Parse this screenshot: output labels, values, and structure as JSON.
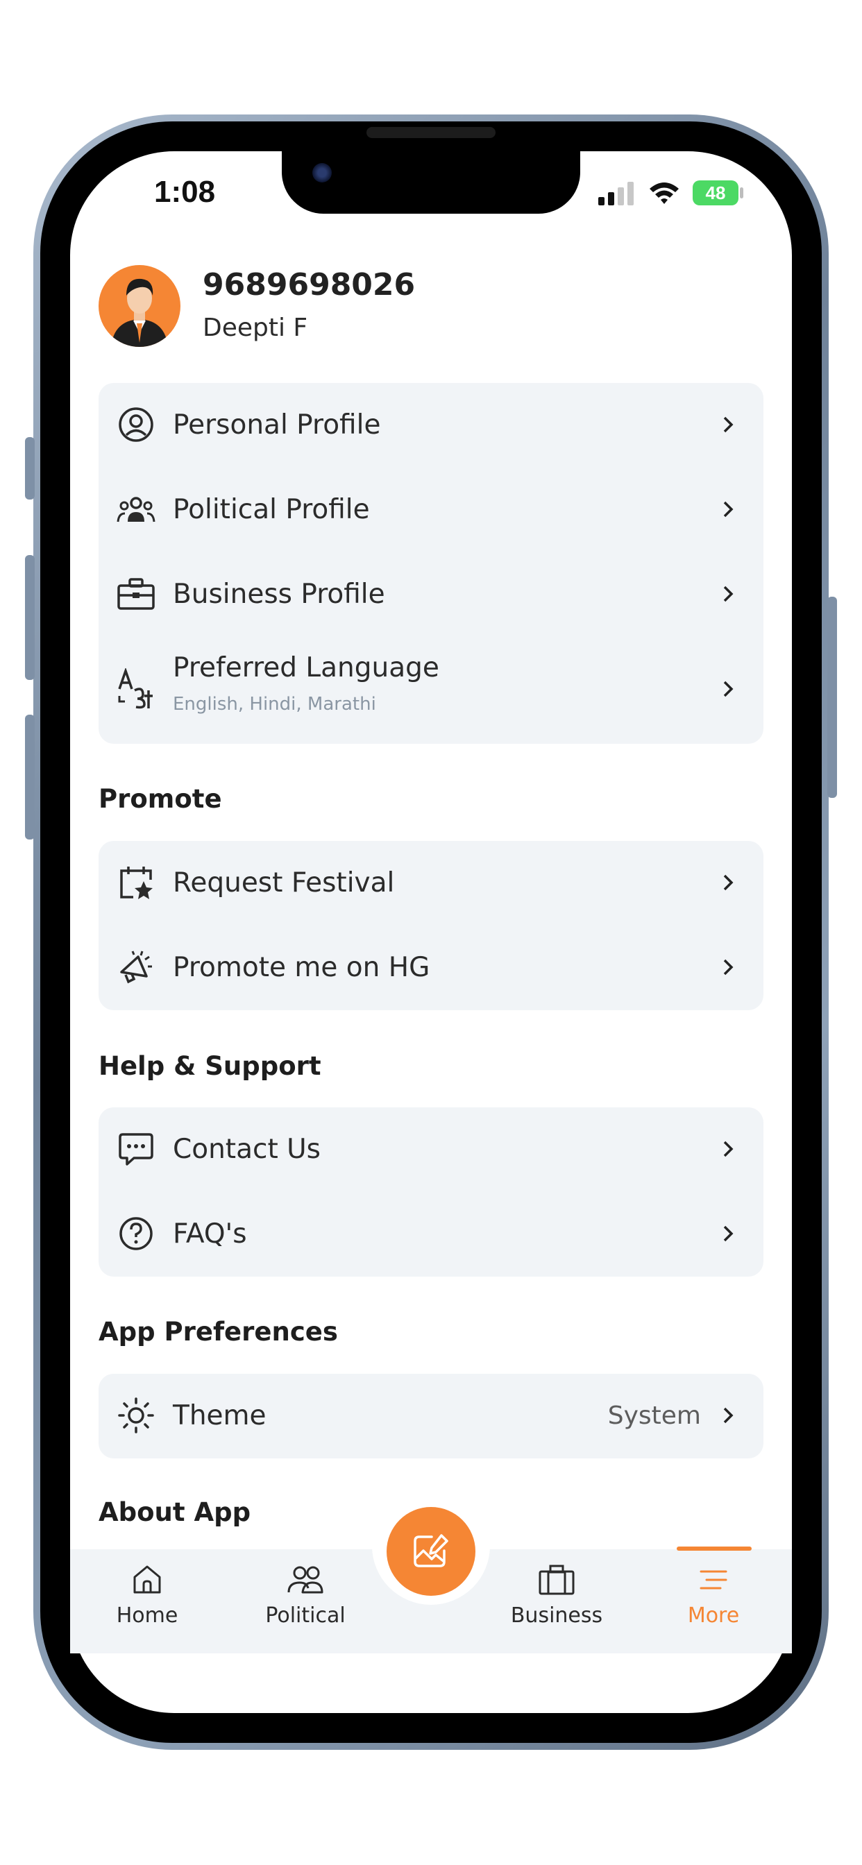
{
  "status": {
    "time": "1:08",
    "battery": "48"
  },
  "profile": {
    "phone": "9689698026",
    "name": "Deepti F"
  },
  "account_menu": [
    {
      "label": "Personal Profile",
      "icon": "user-circle-icon"
    },
    {
      "label": "Political Profile",
      "icon": "group-icon"
    },
    {
      "label": "Business Profile",
      "icon": "briefcase-icon"
    },
    {
      "label": "Preferred Language",
      "sub": "English, Hindi, Marathi",
      "icon": "language-icon"
    }
  ],
  "sections": {
    "promote": "Promote",
    "help": "Help & Support",
    "preferences": "App Preferences",
    "about": "About App"
  },
  "promote_menu": [
    {
      "label": "Request Festival",
      "icon": "calendar-star-icon"
    },
    {
      "label": "Promote me on HG",
      "icon": "megaphone-icon"
    }
  ],
  "help_menu": [
    {
      "label": "Contact Us",
      "icon": "chat-bubble-icon"
    },
    {
      "label": "FAQ's",
      "icon": "question-circle-icon"
    }
  ],
  "preferences_menu": [
    {
      "label": "Theme",
      "value": "System",
      "icon": "sun-icon"
    }
  ],
  "tabs": [
    {
      "label": "Home",
      "icon": "home-icon",
      "active": false
    },
    {
      "label": "Political",
      "icon": "users-icon",
      "active": false
    },
    {
      "label": "Business",
      "icon": "briefcase-icon",
      "active": false
    },
    {
      "label": "More",
      "icon": "menu-lines-icon",
      "active": true
    }
  ],
  "colors": {
    "accent": "#F58634",
    "card_bg": "#F1F4F7",
    "text": "#2B2B2B",
    "battery": "#4CD964"
  }
}
